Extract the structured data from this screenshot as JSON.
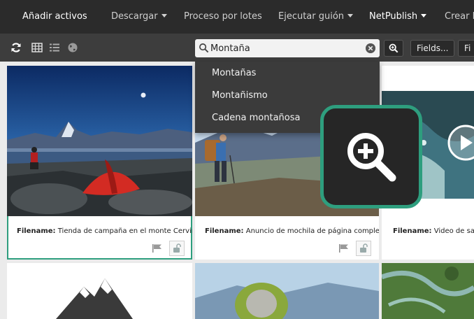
{
  "menu": {
    "add_assets": "Añadir activos",
    "download": "Descargar",
    "batch_process": "Proceso por lotes",
    "run_script": "Ejecutar guión",
    "netpublish": "NetPublish",
    "create": "Crear P"
  },
  "toolbar": {
    "search_value": "Montaña",
    "fields_button": "Fields...",
    "filter_button": "Fi"
  },
  "suggestions": [
    "Montañas",
    "Montañismo",
    "Cadena montañosa"
  ],
  "cards": [
    {
      "label": "Filename:",
      "value": "Tienda de campaña en el monte Cervin"
    },
    {
      "label": "Filename:",
      "value": "Anuncio de mochila de página complet"
    },
    {
      "label": "Filename:",
      "value": "Video de salp"
    }
  ],
  "colors": {
    "menubar": "#2b2b2b",
    "toolbar": "#3d3d3d",
    "accent_green": "#2e9e7e",
    "dropdown": "#3b3b3b"
  },
  "icons": [
    "refresh-icon",
    "grid-view-icon",
    "list-view-icon",
    "globe-icon",
    "search-icon",
    "clear-icon",
    "zoom-in-icon",
    "flag-icon",
    "lock-icon",
    "play-icon"
  ]
}
